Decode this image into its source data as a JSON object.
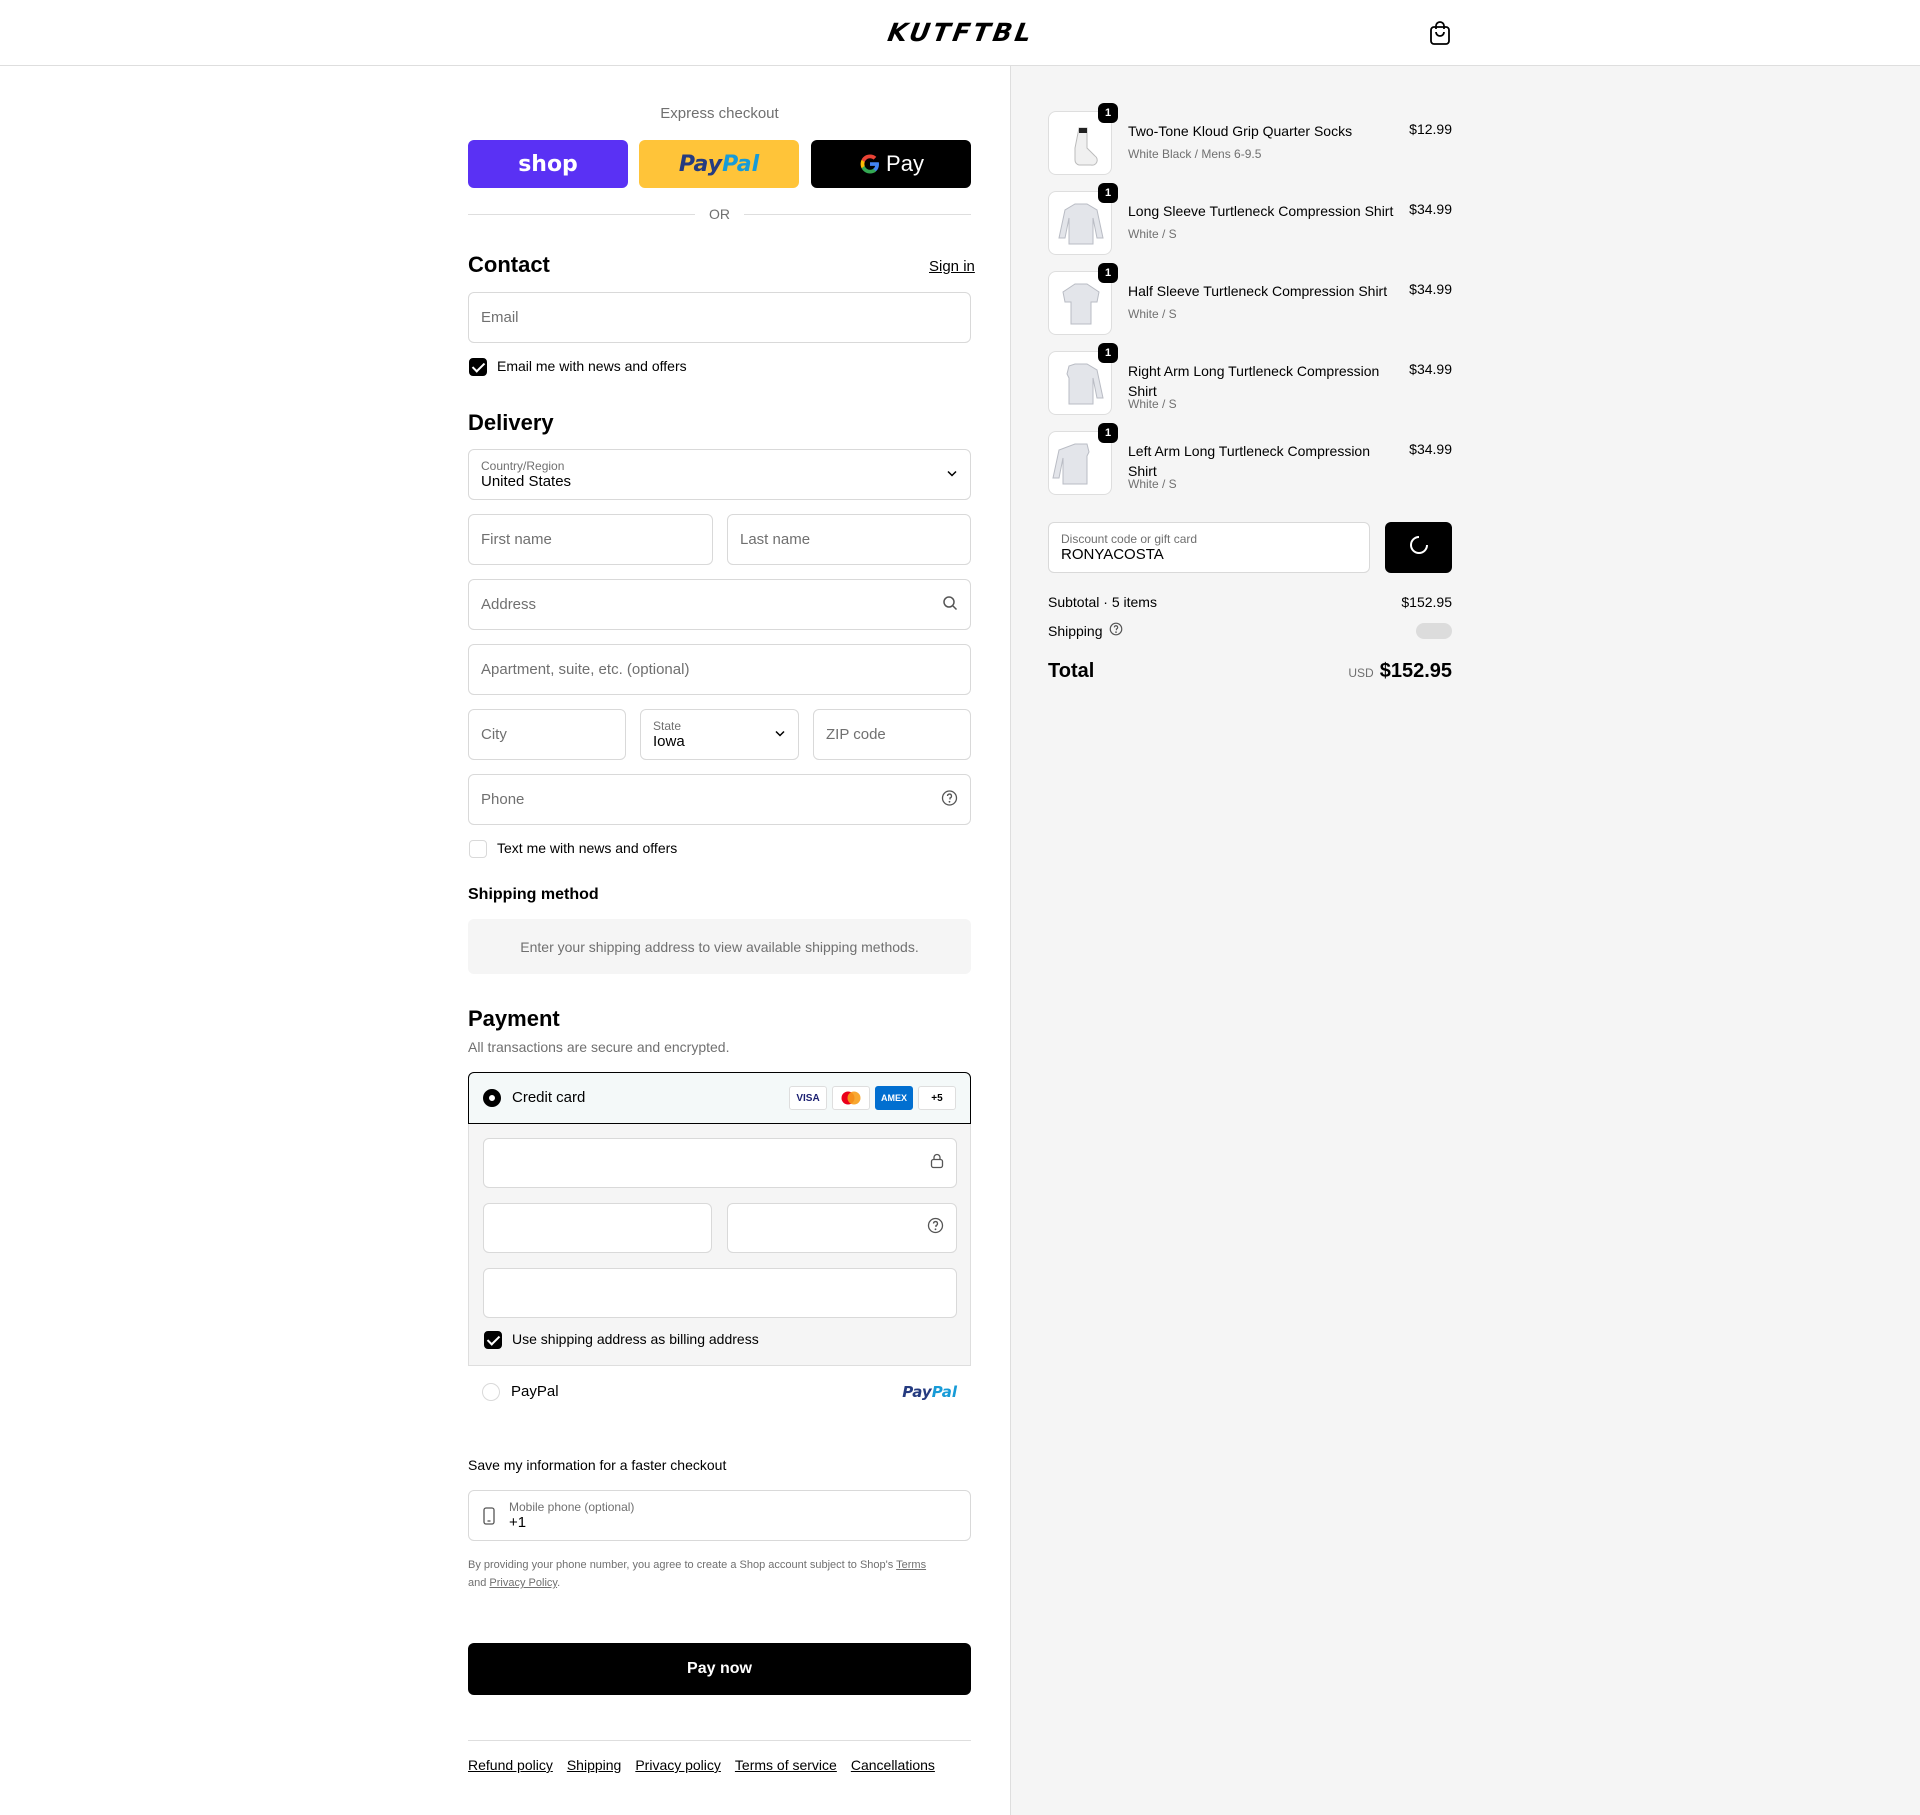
{
  "header": {
    "brand": "KUTFTBL",
    "cart_icon": "shopping-bag-icon"
  },
  "express": {
    "title": "Express checkout",
    "shop_label": "shop",
    "paypal_label_1": "Pay",
    "paypal_label_2": "Pal",
    "gpay_label": "Pay",
    "or_label": "OR"
  },
  "contact": {
    "heading": "Contact",
    "signin_label": "Sign in",
    "email_placeholder": "Email",
    "email_value": "",
    "newsletter_label": "Email me with news and offers",
    "newsletter_checked": true
  },
  "delivery": {
    "heading": "Delivery",
    "country_label": "Country/Region",
    "country_value": "United States",
    "first_name_placeholder": "First name",
    "last_name_placeholder": "Last name",
    "address_placeholder": "Address",
    "apartment_placeholder": "Apartment, suite, etc. (optional)",
    "city_placeholder": "City",
    "state_label": "State",
    "state_value": "Iowa",
    "zip_placeholder": "ZIP code",
    "phone_placeholder": "Phone",
    "sms_label": "Text me with news and offers",
    "sms_checked": false
  },
  "shipping_method": {
    "heading": "Shipping method",
    "message": "Enter your shipping address to view available shipping methods."
  },
  "payment": {
    "heading": "Payment",
    "subtitle": "All transactions are secure and encrypted.",
    "credit_card_label": "Credit card",
    "card_brands": [
      "VISA",
      "MC",
      "AMEX",
      "+5"
    ],
    "billing_label": "Use shipping address as billing address",
    "billing_checked": true,
    "paypal_label": "PayPal",
    "paypal_logo_1": "Pay",
    "paypal_logo_2": "Pal"
  },
  "save_info": {
    "heading": "Save my information for a faster checkout",
    "mobile_label": "Mobile phone (optional)",
    "mobile_value": "+1",
    "disclaimer_pre": "By providing your phone number, you agree to create a Shop account subject to Shop's ",
    "terms_link": "Terms",
    "disclaimer_and": "and ",
    "privacy_link": "Privacy Policy",
    "disclaimer_end": "."
  },
  "pay_button": "Pay now",
  "footer_links": [
    "Refund policy",
    "Shipping",
    "Privacy policy",
    "Terms of service",
    "Cancellations"
  ],
  "cart": {
    "items": [
      {
        "name": "Two-Tone Kloud Grip Quarter Socks",
        "variant": "White Black / Mens 6-9.5",
        "price": "$12.99",
        "qty": "1"
      },
      {
        "name": "Long Sleeve Turtleneck Compression Shirt",
        "variant": "White / S",
        "price": "$34.99",
        "qty": "1"
      },
      {
        "name": "Half Sleeve Turtleneck Compression Shirt",
        "variant": "White / S",
        "price": "$34.99",
        "qty": "1"
      },
      {
        "name": "Right Arm Long Turtleneck Compression Shirt",
        "variant": "White / S",
        "price": "$34.99",
        "qty": "1"
      },
      {
        "name": "Left Arm Long Turtleneck Compression Shirt",
        "variant": "White / S",
        "price": "$34.99",
        "qty": "1"
      }
    ],
    "discount_label": "Discount code or gift card",
    "discount_value": "RONYACOSTA",
    "subtotal_label": "Subtotal · 5 items",
    "subtotal_value": "$152.95",
    "shipping_label": "Shipping",
    "total_label": "Total",
    "currency": "USD",
    "total_value": "$152.95"
  },
  "colors": {
    "shop": "#5a31f4",
    "paypal": "#ffc439",
    "accent": "#000000"
  }
}
